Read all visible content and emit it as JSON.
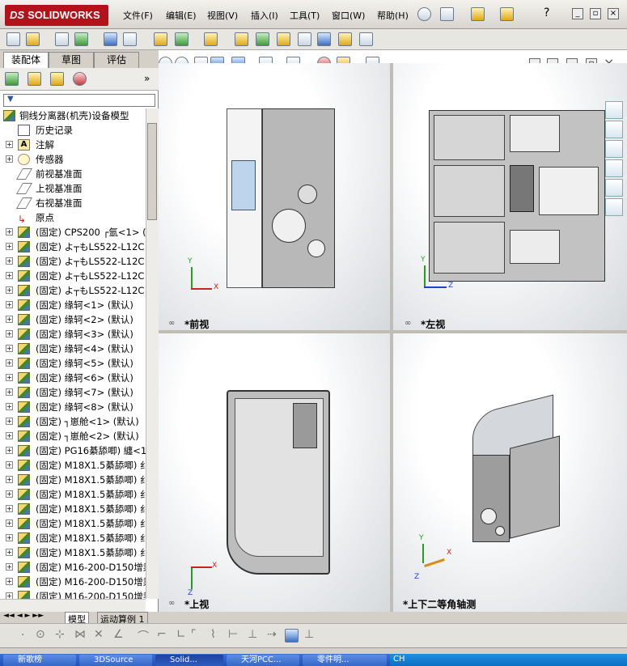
{
  "app": {
    "brand": "SOLIDWORKS",
    "brand_prefix": "DS"
  },
  "menu": [
    {
      "id": "file",
      "label": "文件(F)"
    },
    {
      "id": "edit",
      "label": "编辑(E)"
    },
    {
      "id": "view",
      "label": "视图(V)"
    },
    {
      "id": "insert",
      "label": "插入(I)"
    },
    {
      "id": "tools",
      "label": "工具(T)"
    },
    {
      "id": "window",
      "label": "窗口(W)"
    },
    {
      "id": "help",
      "label": "帮助(H)"
    }
  ],
  "panel_tabs": {
    "assembly": "装配体",
    "sketch": "草图",
    "evaluate": "评估"
  },
  "tree": {
    "root": "铜线分离器(机壳)设备模型",
    "items": [
      {
        "label": "历史记录",
        "icon": "history-icon"
      },
      {
        "label": "注解",
        "icon": "annotation-icon"
      },
      {
        "label": "传感器",
        "icon": "sensor-icon"
      },
      {
        "label": "前视基准面",
        "icon": "plane-icon"
      },
      {
        "label": "上视基准面",
        "icon": "plane-icon"
      },
      {
        "label": "右视基准面",
        "icon": "plane-icon"
      },
      {
        "label": "原点",
        "icon": "origin-icon"
      },
      {
        "label": "(固定) CPS200 ┌氩<1> (",
        "icon": "part-icon"
      },
      {
        "label": "(固定) よ┬もLS522-L12C",
        "icon": "part-icon"
      },
      {
        "label": "(固定) よ┬もLS522-L12C",
        "icon": "part-icon"
      },
      {
        "label": "(固定) よ┬もLS522-L12C",
        "icon": "part-icon"
      },
      {
        "label": "(固定) よ┬もLS522-L12C",
        "icon": "part-icon"
      },
      {
        "label": "(固定)    缘轲<1> (默认)",
        "icon": "part-icon"
      },
      {
        "label": "(固定)    缘轲<2> (默认)",
        "icon": "part-icon"
      },
      {
        "label": "(固定)    缘轲<3> (默认)",
        "icon": "part-icon"
      },
      {
        "label": "(固定)    缘轲<4> (默认)",
        "icon": "part-icon"
      },
      {
        "label": "(固定)    缘轲<5> (默认)",
        "icon": "part-icon"
      },
      {
        "label": "(固定)    缘轲<6> (默认)",
        "icon": "part-icon"
      },
      {
        "label": "(固定)    缘轲<7> (默认)",
        "icon": "part-icon"
      },
      {
        "label": "(固定)    缘轲<8> (默认)",
        "icon": "part-icon"
      },
      {
        "label": "(固定) ┐崽舱<1> (默认)",
        "icon": "part-icon"
      },
      {
        "label": "(固定) ┐崽舱<2> (默认)",
        "icon": "part-icon"
      },
      {
        "label": "(固定) PG16綦舔唧) 纏<1",
        "icon": "part-icon"
      },
      {
        "label": "(固定) M18X1.5綦舔唧) 纟",
        "icon": "part-icon"
      },
      {
        "label": "(固定) M18X1.5綦舔唧) 纟",
        "icon": "part-icon"
      },
      {
        "label": "(固定) M18X1.5綦舔唧) 纟",
        "icon": "part-icon"
      },
      {
        "label": "(固定) M18X1.5綦舔唧) 纟",
        "icon": "part-icon"
      },
      {
        "label": "(固定) M18X1.5綦舔唧) 纟",
        "icon": "part-icon"
      },
      {
        "label": "(固定) M18X1.5綦舔唧) 纟",
        "icon": "part-icon"
      },
      {
        "label": "(固定) M18X1.5綦舔唧) 纟",
        "icon": "part-icon"
      },
      {
        "label": "(固定) M16-200-D150增乘",
        "icon": "part-icon"
      },
      {
        "label": "(固定) M16-200-D150增乘",
        "icon": "part-icon"
      },
      {
        "label": "(固定) M16-200-D150增乘",
        "icon": "part-icon"
      }
    ]
  },
  "bottom_tabs": {
    "model": "模型",
    "motion": "运动算例 1"
  },
  "viewports": {
    "front": "*前视",
    "left": "*左视",
    "top": "*上视",
    "iso": "*上下二等角轴测"
  },
  "axes": {
    "x": "X",
    "y": "Y",
    "z": "Z"
  },
  "taskbar": {
    "start": "新歌榜",
    "items": [
      "3DSource",
      "Solid...",
      "天河PCC...",
      "零件明..."
    ],
    "tray_lang": "CH"
  }
}
